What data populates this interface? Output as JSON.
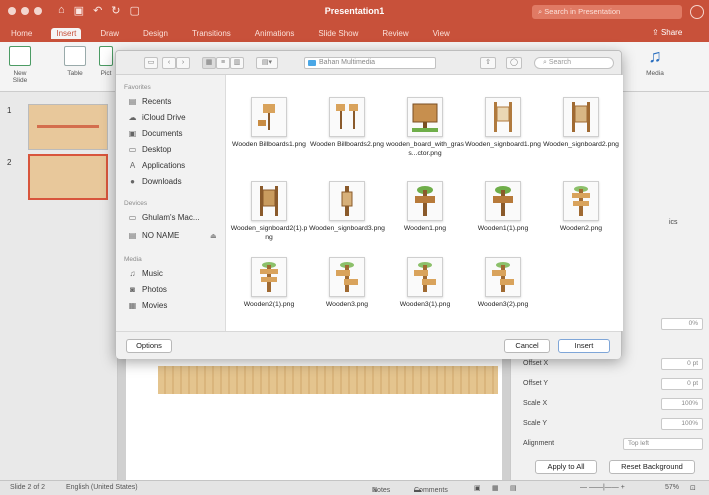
{
  "app": {
    "title": "Presentation1",
    "search_placeholder": "Search in Presentation",
    "share_label": "Share",
    "tabs": [
      "Home",
      "Insert",
      "Draw",
      "Design",
      "Transitions",
      "Animations",
      "Slide Show",
      "Review",
      "View"
    ],
    "active_tab": "Insert"
  },
  "ribbon": {
    "new_slide": "New Slide",
    "table": "Table",
    "pictures": "Pict",
    "media": "Media"
  },
  "slides": [
    "1",
    "2"
  ],
  "dialog": {
    "location": "Bahan Multimedia",
    "search_placeholder": "Search",
    "sidebar": {
      "favorites_header": "Favorites",
      "favorites": [
        "Recents",
        "iCloud Drive",
        "Documents",
        "Desktop",
        "Applications",
        "Downloads"
      ],
      "devices_header": "Devices",
      "devices": [
        "Ghulam's Mac...",
        "NO NAME"
      ],
      "media_header": "Media",
      "media": [
        "Music",
        "Photos",
        "Movies"
      ]
    },
    "files": [
      "Wooden Billboards1.png",
      "Wooden Billboards2.png",
      "wooden_board_with_grass...ctor.png",
      "Wooden_signboard1.png",
      "Wooden_signboard2.png",
      "Wooden_signboard2(1).png",
      "Wooden_signboard3.png",
      "Wooden1.png",
      "Wooden1(1).png",
      "Wooden2.png",
      "Wooden2(1).png",
      "Wooden3.png",
      "Wooden3(1).png",
      "Wooden3(2).png"
    ],
    "options_label": "Options",
    "cancel_label": "Cancel",
    "insert_label": "Insert"
  },
  "format_pane": {
    "graphics_caption": "ics",
    "transparency_value": "0%",
    "offset_x_label": "Offset X",
    "offset_x_value": "0 pt",
    "offset_y_label": "Offset Y",
    "offset_y_value": "0 pt",
    "scale_x_label": "Scale X",
    "scale_x_value": "100%",
    "scale_y_label": "Scale Y",
    "scale_y_value": "100%",
    "alignment_label": "Alignment",
    "alignment_value": "Top left",
    "apply_all_label": "Apply to All",
    "reset_bg_label": "Reset Background"
  },
  "status": {
    "slide_info": "Slide 2 of 2",
    "language": "English (United States)",
    "notes_label": "Notes",
    "comments_label": "Comments",
    "zoom": "57%"
  },
  "colors": {
    "titlebar": "#c8513a",
    "accent_folder": "#4aa7e6",
    "slide_wood": "#e8c89b"
  }
}
